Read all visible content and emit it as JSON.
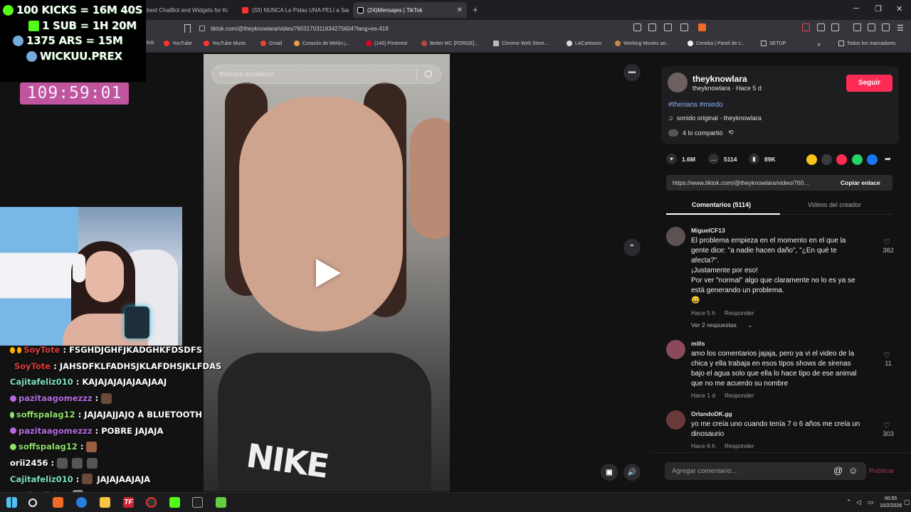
{
  "browser": {
    "tabs": [
      {
        "label": "best ChatBot and Widgets for Ki",
        "active": false
      },
      {
        "label": "(33) NUNCA Le Pidas UNA PELI a Sar",
        "active": false
      },
      {
        "label": "(24)Mensajes | TikTok",
        "active": true
      }
    ],
    "url": "tiktok.com/@theyknowlara/video/7603170311634275604?lang=es-419",
    "bookmarks": [
      "tick",
      "YouTube",
      "YouTube Music",
      "Gmail",
      "Corazón de Melón j...",
      "(146) Pinterest",
      "Better MC [FORGE]...",
      "Chrome Web Store...",
      "LACartoons",
      "Working Movies an...",
      "Ceneka | Panel de c...",
      "SETUP",
      "Todos los marcadores"
    ]
  },
  "overlay": {
    "goals": [
      {
        "text": "100 KICKS = 16M 40S",
        "color": "#53fc18"
      },
      {
        "text": "1 SUB = 1H 20M",
        "color": "#53fc18"
      },
      {
        "text": "1375 ARS = 15M",
        "color": "#75aadb"
      },
      {
        "text": "WICKUU.PREX",
        "color": "#75aadb"
      }
    ],
    "timer": "109:59:01",
    "chat": [
      {
        "user": "SoyTote",
        "color": "#e03a3a",
        "msg": "FSGHDJGHFJKADGHKFDSDFS",
        "badges": true
      },
      {
        "user": "SoyTote",
        "color": "#e03a3a",
        "msg": "JAHSDFKLFADHSJKLAFDHSJKLFDAS",
        "badges": true
      },
      {
        "user": "Cajitafeliz010",
        "color": "#7ee0c0",
        "msg": "KAJAJAJAJAJAAJAAJ",
        "badges": false
      },
      {
        "user": "pazitaagomezzz",
        "color": "#b46be0",
        "msg": "",
        "badges": true,
        "emote": true
      },
      {
        "user": "soffspalag12",
        "color": "#8fe06b",
        "msg": "JAJAJAJJAJQ A BLUETOOTH",
        "badges": true
      },
      {
        "user": "pazitaagomezzz",
        "color": "#b46be0",
        "msg": "POBRE JAJAJA",
        "badges": true
      },
      {
        "user": "soffspalag12",
        "color": "#8fe06b",
        "msg": "",
        "badges": true,
        "emote": true
      },
      {
        "user": "orii2456",
        "color": "#ffffff",
        "msg": "",
        "badges": false,
        "emote": true
      },
      {
        "user": "Cajitafeliz010",
        "color": "#7ee0c0",
        "msg": "JAJAJAAJAJA",
        "badges": false,
        "emote": true
      },
      {
        "user": "SoyTote",
        "color": "#e03a3a",
        "msg": "",
        "badges": true,
        "emote": true
      }
    ]
  },
  "video": {
    "search_placeholder": "therians acuaticos",
    "shirt_logo": "NIKE"
  },
  "post": {
    "username": "theyknowlara",
    "subline": "theyknowlara · Hace 5 d",
    "follow_label": "Seguir",
    "hashtags": "#therians #miedo",
    "sound": "sonido original - theyknowlara",
    "shared": "4 lo compartió",
    "likes": "1.6M",
    "comments_count": "5114",
    "saves": "89K",
    "link": "https://www.tiktok.com/@theyknowlara/video/760...",
    "copy_label": "Copiar enlace",
    "tab_comments": "Comentarios (5114)",
    "tab_creator": "Videos del creador"
  },
  "comments": [
    {
      "user": "MiguelCF13",
      "lines": [
        "El problema empieza en el momento en el que la",
        "gente dice: \"a nadie hacen daño\", \"¿En qué te",
        "afecta?\".",
        "¡Justamente por eso!",
        "Por ver \"normal\" algo que claramente no lo es ya se",
        "está generando un problema.",
        "😄"
      ],
      "time": "Hace 5 h",
      "reply": "Responder",
      "likes": "382",
      "replies": "Ver 2 respuestas"
    },
    {
      "user": "mills",
      "lines": [
        "amo los comentarios jajaja, pero ya vi el video de la",
        "chica y ella trabaja en esos tipos shows de sirenas",
        "bajo el agua solo que ella lo hace tipo de ese animal",
        "que no me acuerdo su nombre"
      ],
      "time": "Hace 1 d",
      "reply": "Responder",
      "likes": "11"
    },
    {
      "user": "OrlandoDK.gg",
      "lines": [
        "yo me creía uno cuando tenía 7 o 6 años me creía un",
        "dinosaurio"
      ],
      "time": "Hace 6 h",
      "reply": "Responder",
      "likes": "303"
    }
  ],
  "composer": {
    "placeholder": "Agregar comentario...",
    "publish": "Publicar"
  },
  "taskbar": {
    "time": "00:55",
    "date": "10/2/2026"
  }
}
